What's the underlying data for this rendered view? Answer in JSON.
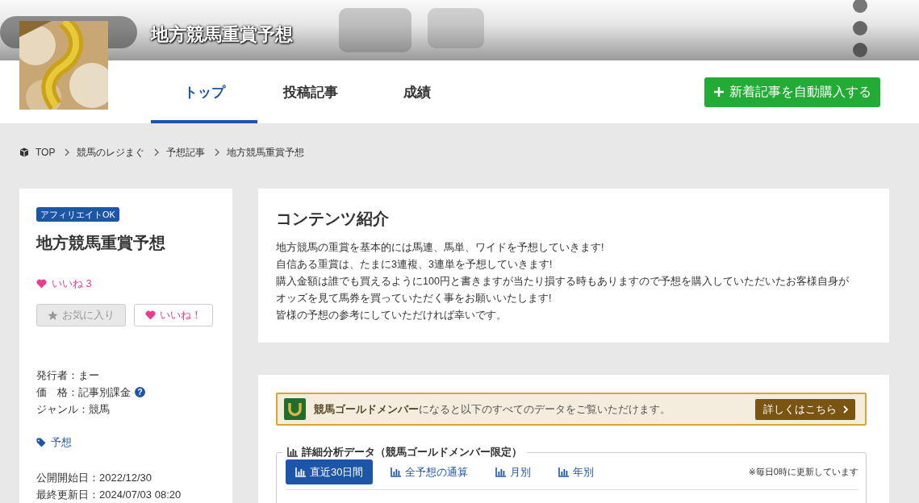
{
  "header": {
    "title": "地方競馬重賞予想"
  },
  "tabs": [
    {
      "label": "トップ",
      "selected": true
    },
    {
      "label": "投稿記事",
      "selected": false
    },
    {
      "label": "成績",
      "selected": false
    }
  ],
  "subscribe_button": {
    "label": "新着記事を自動購入する"
  },
  "breadcrumb": [
    "TOP",
    "競馬のレジまぐ",
    "予想記事",
    "地方競馬重賞予想"
  ],
  "sidebar": {
    "badge": "アフィリエイトOK",
    "title": "地方競馬重賞予想",
    "likes": "いいね 3",
    "favorite_button": {
      "label": "お気に入り",
      "disabled": true
    },
    "like_button": {
      "label": "いいね！"
    },
    "details": [
      {
        "text": "発行者：まー"
      },
      {
        "text": "価　格：記事別課金",
        "help": "?"
      },
      {
        "text": "ジャンル：競馬"
      }
    ],
    "tag": "予想",
    "dates": [
      "公開開始日：2022/12/30",
      "最終更新日：2024/07/03 08:20"
    ]
  },
  "intro": {
    "title": "コンテンツ紹介",
    "lines": [
      "地方競馬の重賞を基本的には馬連、馬単、ワイドを予想していきます!",
      "自信ある重賞は、たまに3連複、3連単を予想していきます!",
      "購入金額は誰でも買えるように100円と書きますが当たり損する時もありますので予想を購入していただいたお客様自身が",
      "オッズを見て馬券を買っていただく事をお願いいたします!",
      "皆様の予想の参考にしていただければ幸いです。"
    ]
  },
  "member": {
    "message": "**競馬ゴールドメンバー**になると以下のすべてのデータをご覧いただけます。",
    "button": "詳しくはこちら"
  },
  "analysis": {
    "title": "詳細分析データ（競馬ゴールドメンバー限定）",
    "tabs": [
      {
        "label": "直近30日間",
        "selected": true
      },
      {
        "label": "全予想の通算",
        "selected": false
      },
      {
        "label": "月別",
        "selected": false
      },
      {
        "label": "年別",
        "selected": false
      }
    ],
    "note": "※毎日0時に更新しています"
  }
}
